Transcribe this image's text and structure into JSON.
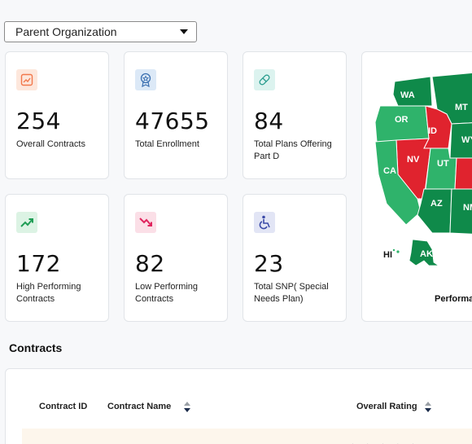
{
  "filter": {
    "selected": "Parent Organization"
  },
  "cards": [
    {
      "value": "254",
      "label": "Overall Contracts",
      "icon": "chart-icon",
      "color": "#f2784b"
    },
    {
      "value": "47655",
      "label": "Total Enrollment",
      "icon": "award-icon",
      "color": "#3a6fb0"
    },
    {
      "value": "84",
      "label": "Total Plans Offering Part D",
      "icon": "pill-icon",
      "color": "#2a9d8f"
    },
    {
      "value": "172",
      "label": "High Performing Contracts",
      "icon": "trending-up-icon",
      "color": "#1f9d55"
    },
    {
      "value": "82",
      "label": "Low Performing Contracts",
      "icon": "trending-down-icon",
      "color": "#e0245e"
    },
    {
      "value": "23",
      "label": "Total SNP( Special Needs Plan)",
      "icon": "wheelchair-icon",
      "color": "#3b4aa8"
    }
  ],
  "map": {
    "states": [
      "WA",
      "MT",
      "OR",
      "ID",
      "WY",
      "NV",
      "UT",
      "CA",
      "AZ",
      "NM",
      "AK",
      "HI"
    ],
    "legend_label": "Performa"
  },
  "contracts": {
    "title": "Contracts",
    "columns": [
      "Contract ID",
      "Contract Name",
      "Overall Rating"
    ]
  },
  "colors": {
    "good": "#0f8a4a",
    "mid": "#2fb36b",
    "bad": "#e0232e"
  }
}
